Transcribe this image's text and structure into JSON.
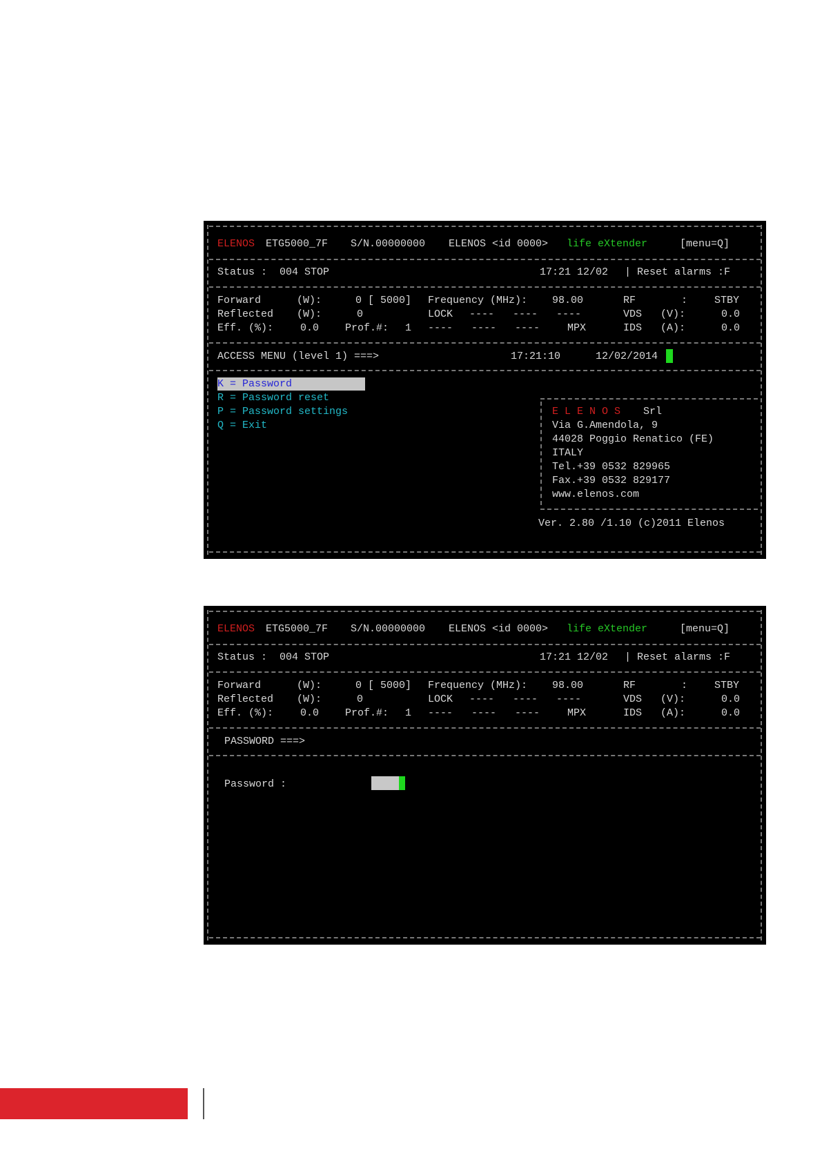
{
  "header": {
    "brand": "ELENOS",
    "model": "ETG5000_7F",
    "serial": "S/N.00000000",
    "vendor_id": "ELENOS <id 0000>",
    "tagline": "life eXtender",
    "menu_hint": "[menu=Q]"
  },
  "status_line": {
    "status_label": "Status :",
    "status_value": "004 STOP",
    "time": "17:21 12/02",
    "reset_hint": "| Reset alarms :F"
  },
  "readings": {
    "forward_label": "Forward",
    "forward_unit": "(W):",
    "forward_value": "0 [ 5000]",
    "reflected_label": "Reflected",
    "reflected_unit": "(W):",
    "reflected_value": "0",
    "eff_label": "Eff. (%):",
    "eff_value": "0.0",
    "prof_label": "Prof.#:",
    "prof_value": "1",
    "freq_label": "Frequency (MHz):",
    "freq_value": "98.00",
    "lock_label": "LOCK",
    "lock_dashes": "----   ----   ----",
    "mpx_dashes": "----   ----   ----",
    "mpx_label": "MPX",
    "rf_label": "RF",
    "rf_sep": ":",
    "rf_value": "STBY",
    "vds_label": "VDS",
    "vds_unit": "(V):",
    "vds_value": "0.0",
    "ids_label": "IDS",
    "ids_unit": "(A):",
    "ids_value": "0.0"
  },
  "screen1": {
    "menu_title": "ACCESS MENU (level 1) ===>",
    "clock": "17:21:10",
    "date": "12/02/2014",
    "options": [
      "K = Password",
      "R = Password reset",
      "P = Password settings",
      "Q = Exit"
    ],
    "company_box": {
      "name_spaced": "E L E N O S",
      "name_suffix": "Srl",
      "address": "Via G.Amendola, 9",
      "city": "44028 Poggio Renatico (FE)",
      "country": "ITALY",
      "tel": "Tel.+39 0532 829965",
      "fax": "Fax.+39 0532 829177",
      "web": "www.elenos.com"
    },
    "version": "Ver. 2.80 /1.10 (c)2011 Elenos"
  },
  "screen2": {
    "menu_title": "PASSWORD ===>",
    "password_label": "Password :"
  },
  "colors": {
    "brand_red": "#d21f1f",
    "tagline_green": "#26c826",
    "menu_cyan": "#22b9c8",
    "selected_blue": "#2626d6",
    "cursor_green": "#1ed81e",
    "page_accent_red": "#dc242c"
  }
}
